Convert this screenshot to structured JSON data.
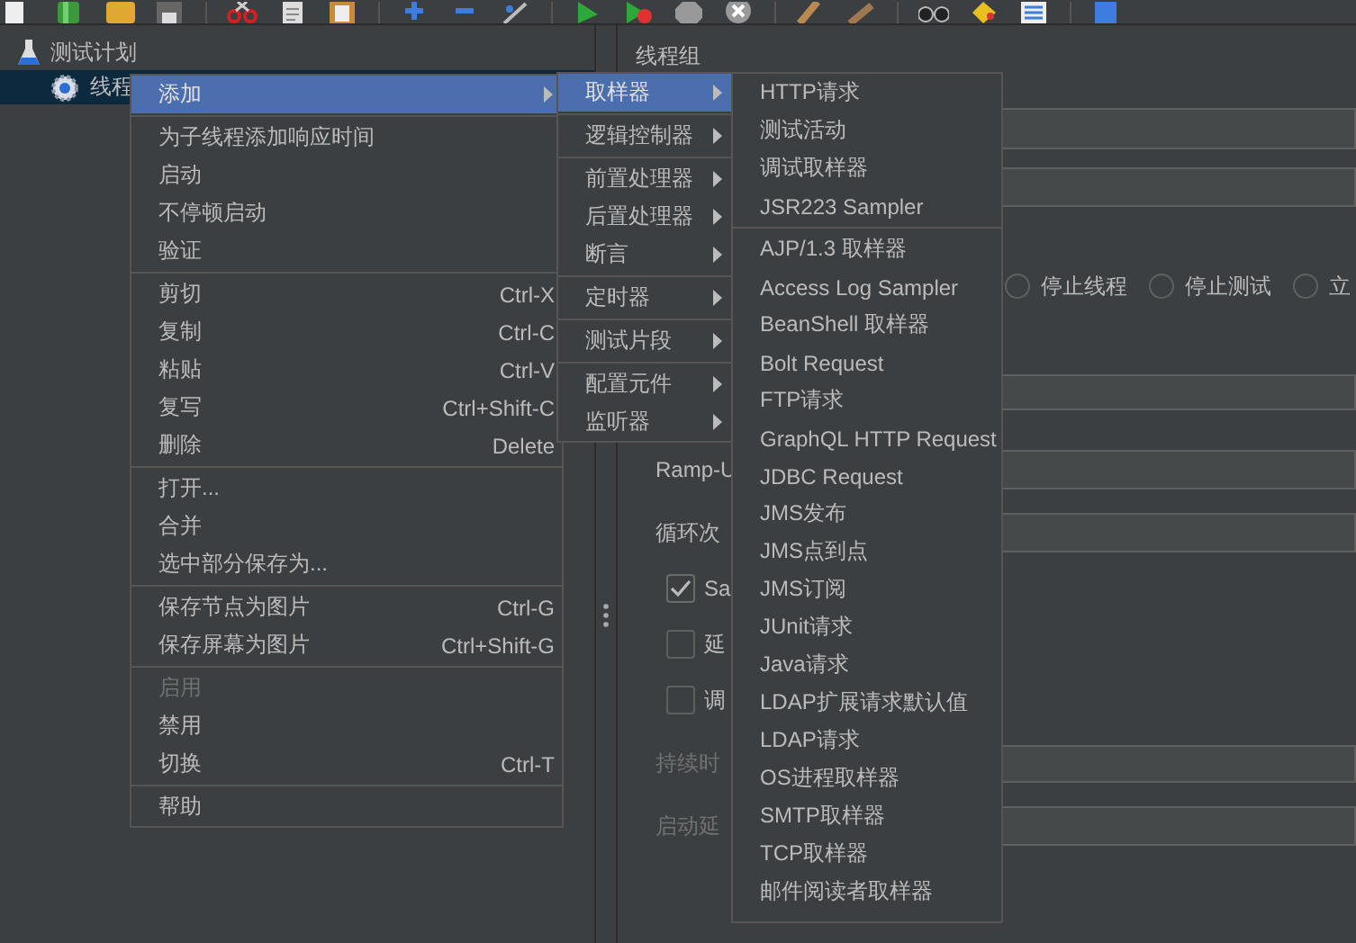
{
  "tree": [
    {
      "label": "测试计划",
      "kind": "test_plan",
      "selected": false,
      "children": [
        {
          "label": "线程",
          "kind": "thread_group",
          "selected": true
        }
      ]
    }
  ],
  "panel": {
    "title": "线程组",
    "error_actions": [
      {
        "label": "停止线程",
        "selected": false
      },
      {
        "label": "停止测试",
        "selected": false
      },
      {
        "label": "立",
        "selected": false
      }
    ],
    "thread_properties": [
      {
        "kind": "field",
        "label": "Ramp-U",
        "disabled": false
      },
      {
        "kind": "field",
        "label": "循环次",
        "disabled": false
      },
      {
        "kind": "checkbox",
        "label": "Sa",
        "checked": true,
        "disabled": false
      },
      {
        "kind": "checkbox",
        "label": "延",
        "checked": false,
        "disabled": false
      },
      {
        "kind": "checkbox",
        "label": "调",
        "checked": false,
        "disabled": false
      },
      {
        "kind": "field",
        "label": "持续时",
        "disabled": true
      },
      {
        "kind": "field",
        "label": "启动延",
        "disabled": true
      }
    ]
  },
  "context_menu": {
    "groups": [
      [
        {
          "label": "添加",
          "submenu": true,
          "selected": true,
          "disabled": false
        }
      ],
      [
        {
          "label": "为子线程添加响应时间",
          "submenu": false,
          "selected": false,
          "disabled": false
        },
        {
          "label": "启动",
          "submenu": false,
          "selected": false,
          "disabled": false
        },
        {
          "label": "不停顿启动",
          "submenu": false,
          "selected": false,
          "disabled": false
        },
        {
          "label": "验证",
          "submenu": false,
          "selected": false,
          "disabled": false
        }
      ],
      [
        {
          "label": "剪切",
          "shortcut": "Ctrl-X",
          "submenu": false,
          "selected": false,
          "disabled": false
        },
        {
          "label": "复制",
          "shortcut": "Ctrl-C",
          "submenu": false,
          "selected": false,
          "disabled": false
        },
        {
          "label": "粘贴",
          "shortcut": "Ctrl-V",
          "submenu": false,
          "selected": false,
          "disabled": false
        },
        {
          "label": "复写",
          "shortcut": "Ctrl+Shift-C",
          "submenu": false,
          "selected": false,
          "disabled": false
        },
        {
          "label": "删除",
          "shortcut": "Delete",
          "submenu": false,
          "selected": false,
          "disabled": false
        }
      ],
      [
        {
          "label": "打开...",
          "submenu": false,
          "selected": false,
          "disabled": false
        },
        {
          "label": "合并",
          "submenu": false,
          "selected": false,
          "disabled": false
        },
        {
          "label": "选中部分保存为...",
          "submenu": false,
          "selected": false,
          "disabled": false
        }
      ],
      [
        {
          "label": "保存节点为图片",
          "shortcut": "Ctrl-G",
          "submenu": false,
          "selected": false,
          "disabled": false
        },
        {
          "label": "保存屏幕为图片",
          "shortcut": "Ctrl+Shift-G",
          "submenu": false,
          "selected": false,
          "disabled": false
        }
      ],
      [
        {
          "label": "启用",
          "submenu": false,
          "selected": false,
          "disabled": true
        },
        {
          "label": "禁用",
          "submenu": false,
          "selected": false,
          "disabled": false
        },
        {
          "label": "切换",
          "shortcut": "Ctrl-T",
          "submenu": false,
          "selected": false,
          "disabled": false
        }
      ],
      [
        {
          "label": "帮助",
          "submenu": false,
          "selected": false,
          "disabled": false
        }
      ]
    ]
  },
  "add_submenu": {
    "groups": [
      [
        {
          "label": "取样器",
          "submenu": true,
          "selected": true,
          "disabled": false
        }
      ],
      [
        {
          "label": "逻辑控制器",
          "submenu": true,
          "selected": false,
          "disabled": false
        }
      ],
      [
        {
          "label": "前置处理器",
          "submenu": true,
          "selected": false,
          "disabled": false
        },
        {
          "label": "后置处理器",
          "submenu": true,
          "selected": false,
          "disabled": false
        },
        {
          "label": "断言",
          "submenu": true,
          "selected": false,
          "disabled": false
        }
      ],
      [
        {
          "label": "定时器",
          "submenu": true,
          "selected": false,
          "disabled": false
        }
      ],
      [
        {
          "label": "测试片段",
          "submenu": true,
          "selected": false,
          "disabled": false
        }
      ],
      [
        {
          "label": "配置元件",
          "submenu": true,
          "selected": false,
          "disabled": false
        },
        {
          "label": "监听器",
          "submenu": true,
          "selected": false,
          "disabled": false
        }
      ]
    ]
  },
  "sampler_submenu": {
    "groups": [
      [
        {
          "label": "HTTP请求",
          "submenu": false,
          "selected": false,
          "disabled": false
        },
        {
          "label": "测试活动",
          "submenu": false,
          "selected": false,
          "disabled": false
        },
        {
          "label": "调试取样器",
          "submenu": false,
          "selected": false,
          "disabled": false
        },
        {
          "label": "JSR223 Sampler",
          "submenu": false,
          "selected": false,
          "disabled": false
        }
      ],
      [
        {
          "label": "AJP/1.3 取样器",
          "submenu": false,
          "selected": false,
          "disabled": false
        },
        {
          "label": "Access Log Sampler",
          "submenu": false,
          "selected": false,
          "disabled": false
        },
        {
          "label": "BeanShell 取样器",
          "submenu": false,
          "selected": false,
          "disabled": false
        },
        {
          "label": "Bolt Request",
          "submenu": false,
          "selected": false,
          "disabled": false
        },
        {
          "label": "FTP请求",
          "submenu": false,
          "selected": false,
          "disabled": false
        },
        {
          "label": "GraphQL HTTP Request",
          "submenu": false,
          "selected": false,
          "disabled": false
        },
        {
          "label": "JDBC Request",
          "submenu": false,
          "selected": false,
          "disabled": false
        },
        {
          "label": "JMS发布",
          "submenu": false,
          "selected": false,
          "disabled": false
        },
        {
          "label": "JMS点到点",
          "submenu": false,
          "selected": false,
          "disabled": false
        },
        {
          "label": "JMS订阅",
          "submenu": false,
          "selected": false,
          "disabled": false
        },
        {
          "label": "JUnit请求",
          "submenu": false,
          "selected": false,
          "disabled": false
        },
        {
          "label": "Java请求",
          "submenu": false,
          "selected": false,
          "disabled": false
        },
        {
          "label": "LDAP扩展请求默认值",
          "submenu": false,
          "selected": false,
          "disabled": false
        },
        {
          "label": "LDAP请求",
          "submenu": false,
          "selected": false,
          "disabled": false
        },
        {
          "label": "OS进程取样器",
          "submenu": false,
          "selected": false,
          "disabled": false
        },
        {
          "label": "SMTP取样器",
          "submenu": false,
          "selected": false,
          "disabled": false
        },
        {
          "label": "TCP取样器",
          "submenu": false,
          "selected": false,
          "disabled": false
        },
        {
          "label": "邮件阅读者取样器",
          "submenu": false,
          "selected": false,
          "disabled": false
        }
      ]
    ]
  }
}
